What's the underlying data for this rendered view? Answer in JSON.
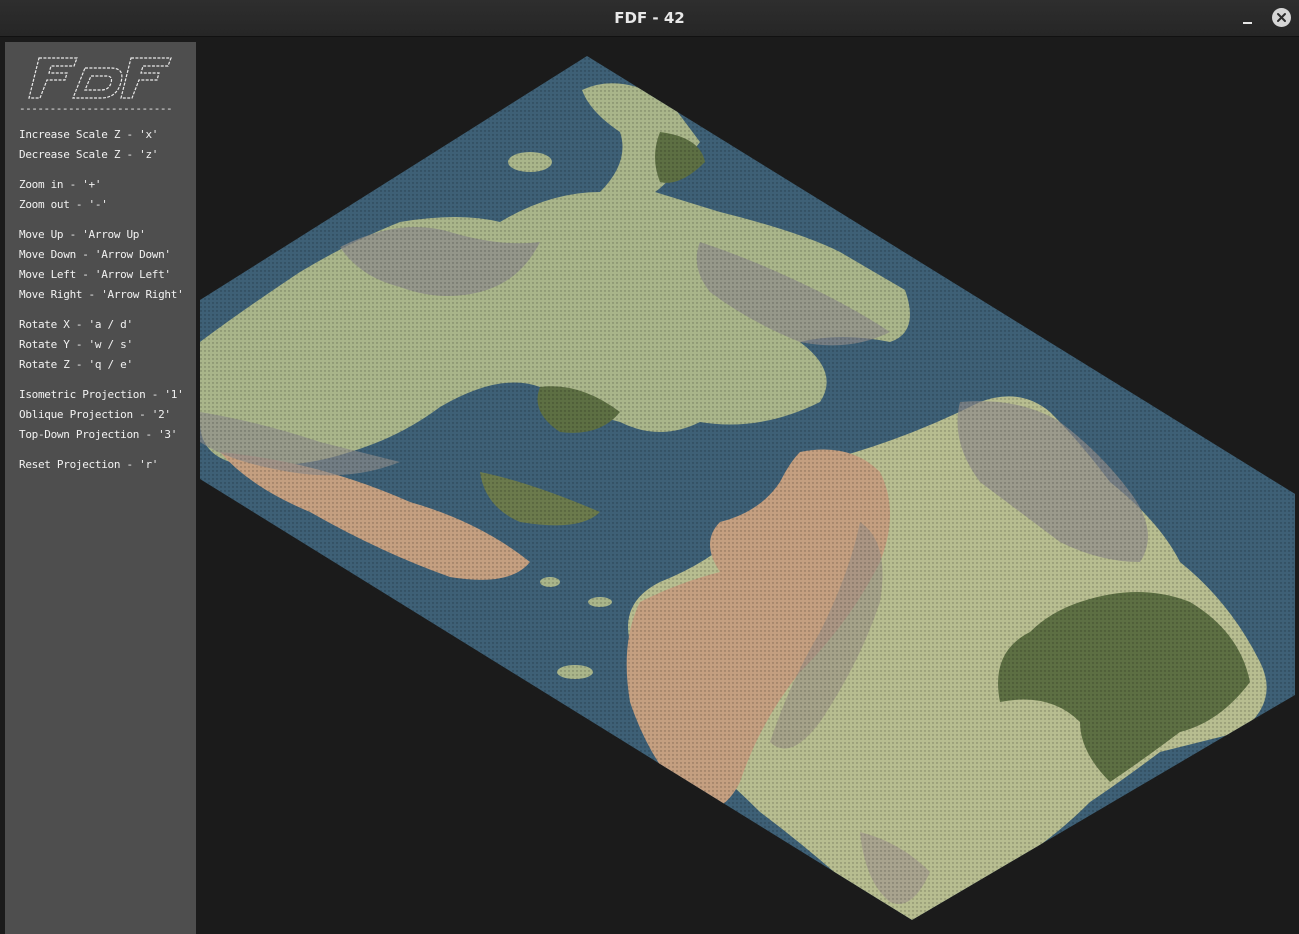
{
  "window": {
    "title": "FDF - 42"
  },
  "sidebar": {
    "logo_text": "FDF",
    "divider": "-------------------------",
    "controls": [
      {
        "text": "Increase Scale Z - 'x'",
        "gap": false
      },
      {
        "text": "Decrease Scale Z - 'z'",
        "gap": false
      },
      {
        "text": "Zoom in - '+'",
        "gap": true
      },
      {
        "text": "Zoom out - '-'",
        "gap": false
      },
      {
        "text": "Move Up - 'Arrow Up'",
        "gap": true
      },
      {
        "text": "Move Down - 'Arrow Down'",
        "gap": false
      },
      {
        "text": "Move Left - 'Arrow Left'",
        "gap": false
      },
      {
        "text": "Move Right - 'Arrow Right'",
        "gap": false
      },
      {
        "text": "Rotate X - 'a / d'",
        "gap": true
      },
      {
        "text": "Rotate Y - 'w / s'",
        "gap": false
      },
      {
        "text": "Rotate Z - 'q / e'",
        "gap": false
      },
      {
        "text": "Isometric Projection - '1'",
        "gap": true
      },
      {
        "text": "Oblique Projection - '2'",
        "gap": false
      },
      {
        "text": "Top-Down Projection - '3'",
        "gap": false
      },
      {
        "text": "Reset Projection - 'r'",
        "gap": true
      }
    ]
  },
  "colors": {
    "water": "#3e6076",
    "land_light": "#a9b58a",
    "land_green": "#5d6f43",
    "land_sand": "#c49f80",
    "mountain": "#8e8c8a",
    "background": "#1b1b1b",
    "sidebar": "#4e4e4e"
  }
}
